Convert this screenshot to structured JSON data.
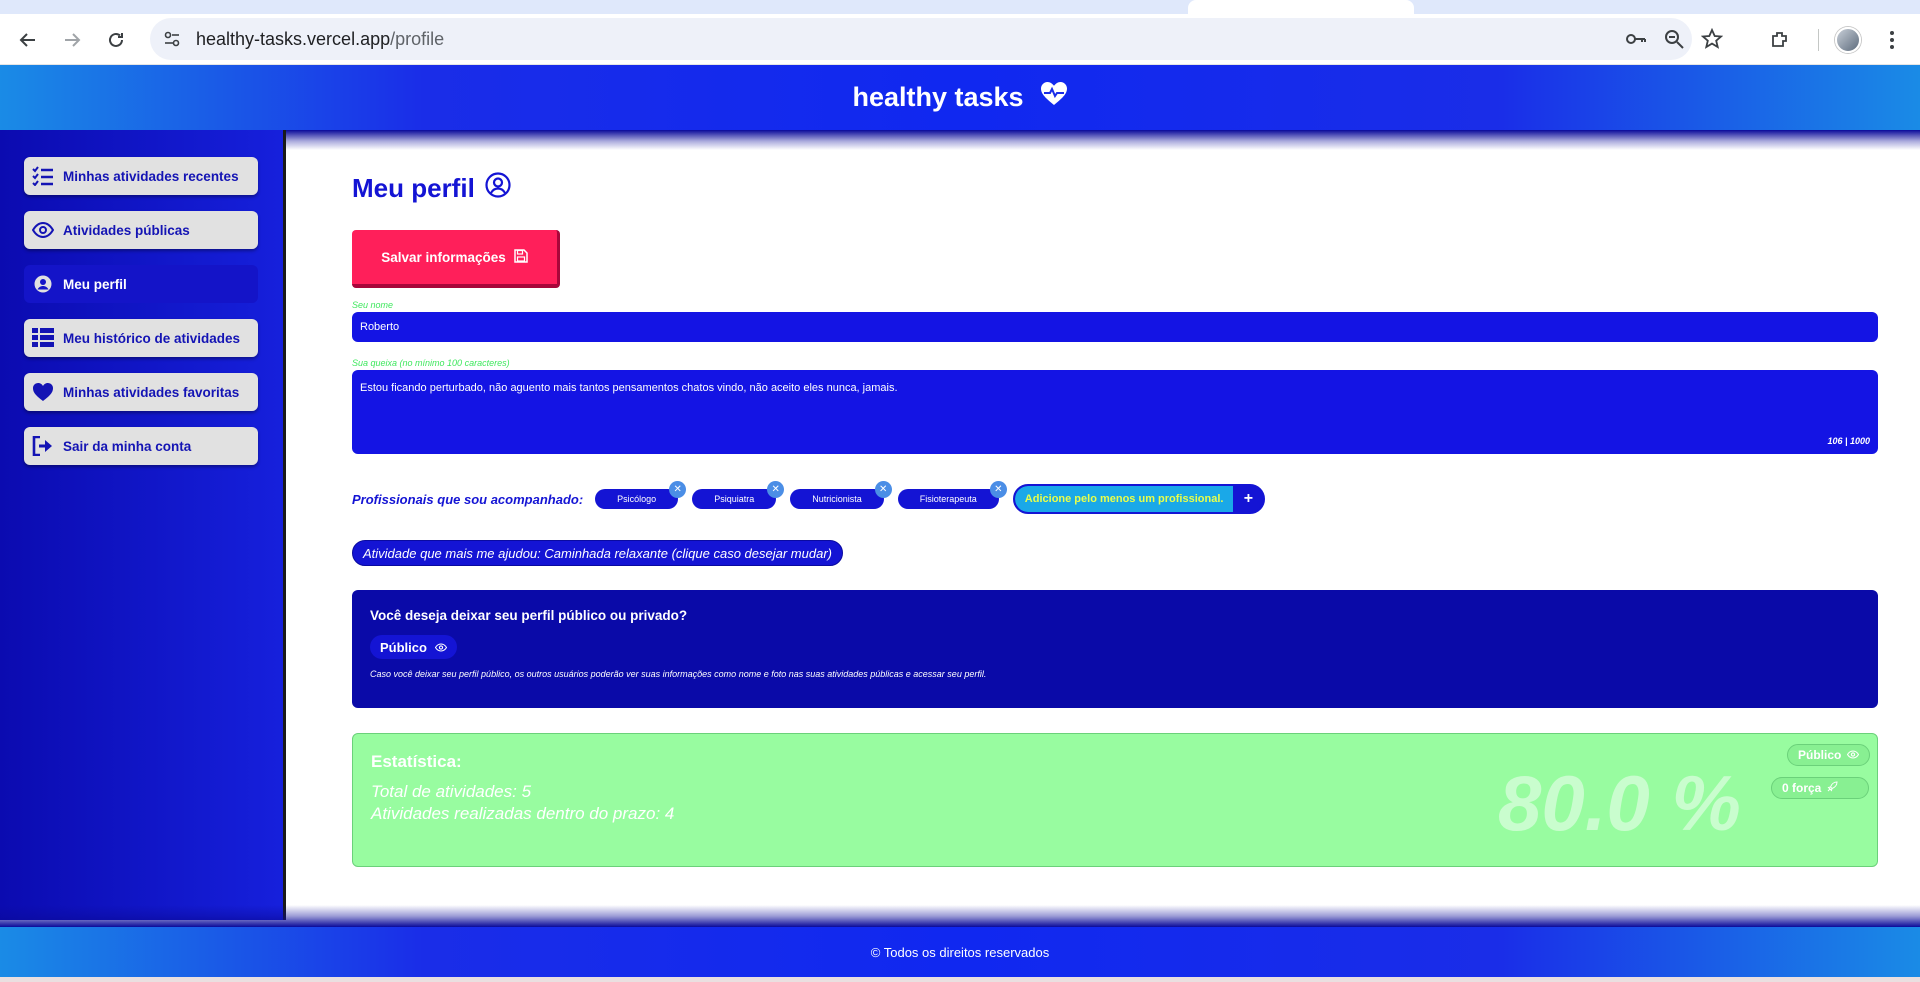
{
  "browser": {
    "url_host": "healthy-tasks.vercel.app",
    "url_path": "/profile"
  },
  "app": {
    "title": "healthy tasks"
  },
  "sidebar": {
    "items": [
      {
        "label": "Minhas atividades recentes",
        "icon": "checklist-icon",
        "active": false
      },
      {
        "label": "Atividades públicas",
        "icon": "eye-icon",
        "active": false
      },
      {
        "label": "Meu perfil",
        "icon": "user-circle-icon",
        "active": true
      },
      {
        "label": "Meu histórico de atividades",
        "icon": "table-list-icon",
        "active": false
      },
      {
        "label": "Minhas atividades favoritas",
        "icon": "heart-icon",
        "active": false
      },
      {
        "label": "Sair da minha conta",
        "icon": "logout-icon",
        "active": false
      }
    ]
  },
  "main": {
    "title": "Meu perfil",
    "save_label": "Salvar informações",
    "name_label": "Seu nome",
    "name_value": "Roberto",
    "complaint_label": "Sua queixa (no mínimo 100 caracteres)",
    "complaint_value": "Estou ficando perturbado, não aguento mais tantos pensamentos chatos vindo, não aceito eles nunca, jamais.",
    "char_count": "106 | 1000",
    "pros_label": "Profissionais que sou acompanhado:",
    "professionals": [
      "Psicólogo",
      "Psiquiatra",
      "Nutricionista",
      "Fisioterapeuta"
    ],
    "add_pro_hint": "Adicione pelo menos um profissional.",
    "add_pro_button": "+",
    "helpful_activity": "Atividade que mais me ajudou: Caminhada relaxante (clique caso desejar mudar)",
    "privacy_question": "Você deseja deixar seu perfil público ou privado?",
    "privacy_value": "Público",
    "privacy_note": "Caso você deixar seu perfil público, os outros usuários poderão ver suas informações como nome e foto nas suas atividades públicas e acessar seu perfil.",
    "stats": {
      "title": "Estatística:",
      "total": "Total de atividades: 5",
      "on_time": "Atividades realizadas dentro do prazo: 4",
      "percent": "80.0 %",
      "chip_public": "Público",
      "chip_force": "0 força"
    }
  },
  "footer": {
    "text": "© Todos os direitos reservados"
  },
  "colors": {
    "primary": "#1414d4",
    "save": "#ff1f5a",
    "stats_bg": "#98fca0"
  }
}
